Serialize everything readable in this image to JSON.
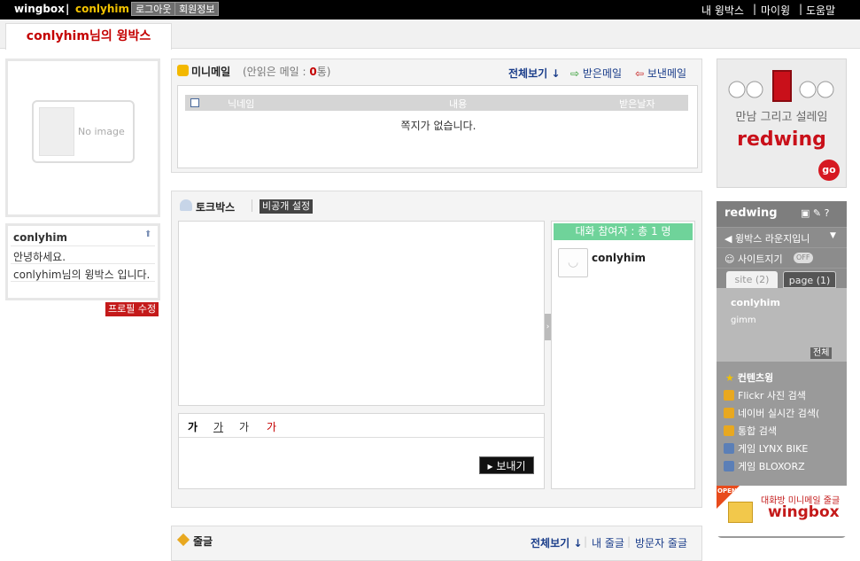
{
  "topbar": {
    "brand": "wingbox",
    "separator": "|",
    "username": "conlyhim",
    "logout_label": "로그아웃",
    "member_info_label": "회원정보",
    "links": [
      "내 윙박스",
      "마이윙",
      "도움말"
    ]
  },
  "page_tab": "conlyhim님의 윙박스",
  "profile": {
    "no_image_text": "No image",
    "name": "conlyhim",
    "greeting": "안녕하세요.",
    "intro": "conlyhim님의 윙박스 입니다.",
    "edit_label": "프로필 수정"
  },
  "mail": {
    "title": "미니메일",
    "unread_prefix": "(안읽은 메일 : ",
    "unread_count": "0",
    "unread_suffix": "통)",
    "view_all": "전체보기",
    "received": "받은메일",
    "sent": "보낸메일",
    "columns": [
      "닉네임",
      "내용",
      "받은날자"
    ],
    "empty_text": "쪽지가 없습니다."
  },
  "talk": {
    "title": "토크박스",
    "private_label": "비공개 설정",
    "format_buttons": [
      "가",
      "가",
      "가",
      "가"
    ],
    "send_label": "보내기",
    "participants_header": "대화 참여자 : 총 1 명",
    "participants": [
      "conlyhim"
    ]
  },
  "guestbook": {
    "title": "줄글",
    "view_all": "전체보기",
    "mine": "내 줄글",
    "visitors": "방문자 줄글"
  },
  "ad": {
    "copy": "만남 그리고 설레임",
    "logo": "redwing",
    "go": "go"
  },
  "redwing": {
    "logo": "redwing",
    "lounge": "윙박스 라운지입니",
    "site_zigi": "사이트지기",
    "off_label": "OFF",
    "tab_site": "site (2)",
    "tab_page": "page (1)",
    "site_user": "conlyhim",
    "site_sub": "gimm",
    "all_label": "전체",
    "contents_title": "컨텐츠윙",
    "contents": [
      "Flickr 사진 검색",
      "네이버 실시간 검색(",
      "통합 검색",
      "게임 LYNX BIKE",
      "게임 BLOXORZ"
    ],
    "footer_sub": "대화방 미니메일 줄글",
    "footer_logo": "wingbox",
    "open_label": "OPEN"
  },
  "colors": {
    "accent_red": "#c40000",
    "brand_yellow": "#f2c200",
    "participant_green": "#6fd39a",
    "link_blue": "#1a3d8a"
  }
}
